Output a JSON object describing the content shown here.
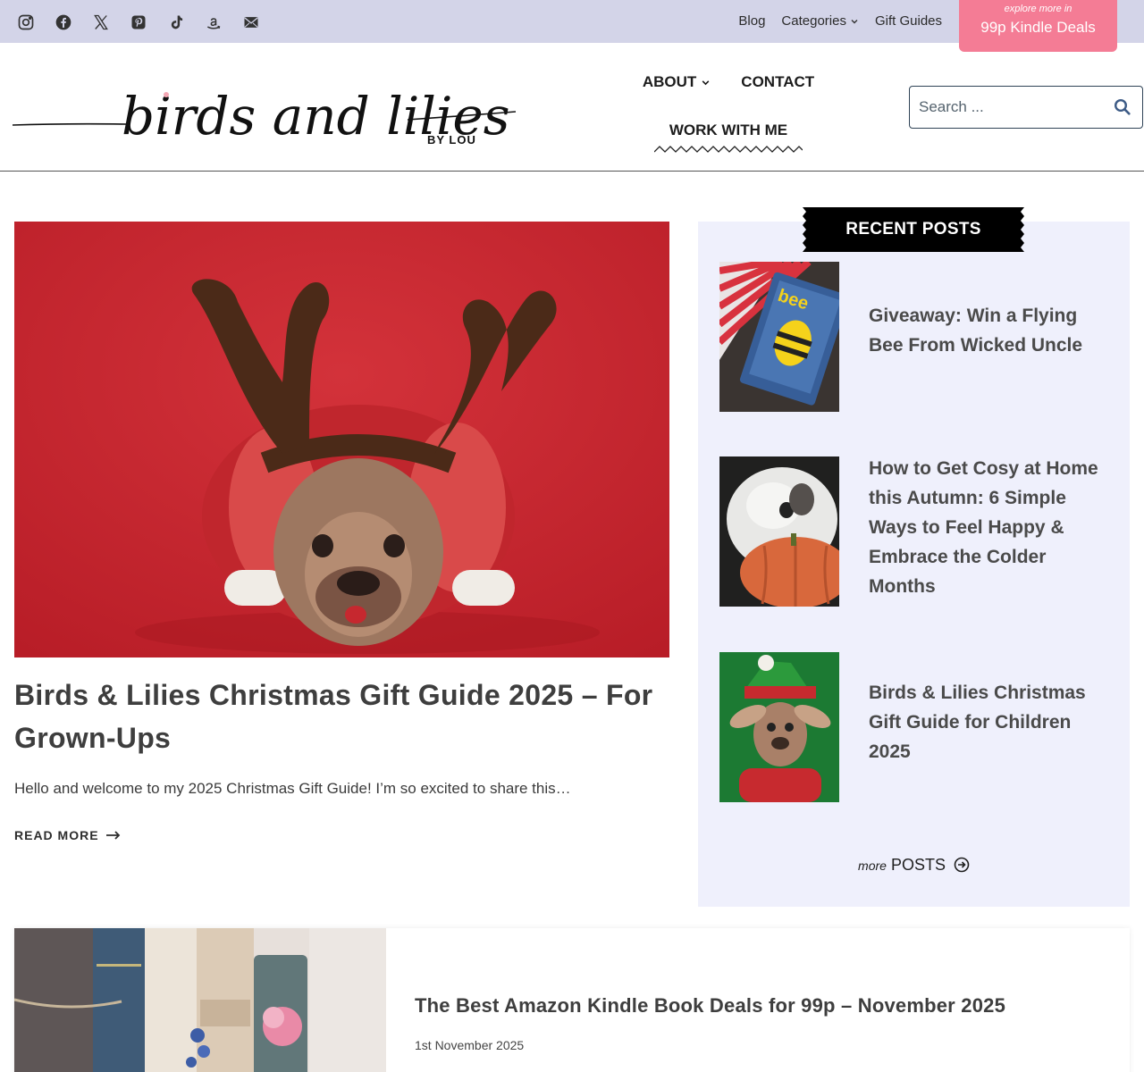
{
  "topbar": {
    "social_icons": [
      "instagram-icon",
      "facebook-icon",
      "x-icon",
      "pinterest-icon",
      "tiktok-icon",
      "amazon-icon",
      "mail-icon"
    ],
    "links": [
      {
        "label": "Blog"
      },
      {
        "label": "Categories"
      },
      {
        "label": "Gift Guides"
      }
    ],
    "promo": {
      "small": "explore more in",
      "big": "99p Kindle Deals"
    }
  },
  "header": {
    "logo": {
      "script_text": "birds and lilies",
      "suffix": "BY LOU"
    },
    "nav": [
      {
        "label": "ABOUT"
      },
      {
        "label": "CONTACT"
      },
      {
        "label": "WORK WITH ME"
      }
    ],
    "search": {
      "placeholder": "Search ..."
    }
  },
  "featured_post": {
    "title": "Birds & Lilies Christmas Gift Guide 2025 – For Grown-Ups",
    "excerpt": "Hello and welcome to my 2025 Christmas Gift Guide! I’m so excited to share this…",
    "read_more": "READ MORE"
  },
  "sidebar": {
    "heading": "RECENT POSTS",
    "posts": [
      {
        "title": "Giveaway: Win a Flying Bee From Wicked Uncle",
        "thumb_text": "bee"
      },
      {
        "title": "How to Get Cosy at Home this Autumn: 6 Simple Ways to Feel Happy & Embrace the Colder Months"
      },
      {
        "title": "Birds & Lilies Christmas Gift Guide for Children 2025"
      }
    ],
    "more": {
      "prefix": "more",
      "label": "POSTS"
    }
  },
  "second_post": {
    "title": "The Best Amazon Kindle Book Deals for 99p – November 2025",
    "date": "1st November 2025"
  },
  "colors": {
    "topbar": "#d3d4e8",
    "promo": "#f47c95",
    "sidebar": "#eff0fc",
    "feature_bg": "#c9252f"
  }
}
